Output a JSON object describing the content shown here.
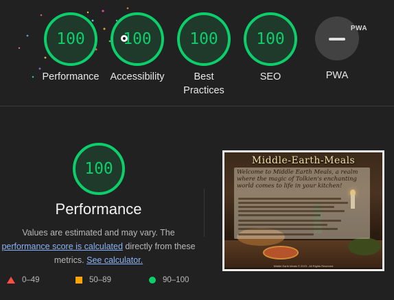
{
  "categories": [
    {
      "name": "performance",
      "score": "100",
      "label": "Performance"
    },
    {
      "name": "accessibility",
      "score": "100",
      "label": "Accessibility"
    },
    {
      "name": "best-practices",
      "score": "100",
      "label": "Best Practices"
    },
    {
      "name": "seo",
      "score": "100",
      "label": "SEO"
    }
  ],
  "pwa": {
    "badge_text": "PWA",
    "label": "PWA"
  },
  "performance_section": {
    "score": "100",
    "title": "Performance",
    "desc_prefix": "Values are estimated and may vary. The ",
    "score_link": "performance score is calculated",
    "desc_middle": " directly from these metrics. ",
    "calculator_link": "See calculator."
  },
  "thumbnail": {
    "site_title": "Middle-Earth-Meals",
    "intro": "Welcome to Middle Earth Meals, a realm where the magic of Tolkien's enchanting world comes to life in your kitchen!",
    "footer": "Middle Earth Meals © 2023 - All Rights Reserved"
  },
  "legend": [
    {
      "shape": "triangle",
      "color": "#ff4e42",
      "range": "0–49"
    },
    {
      "shape": "square",
      "color": "#ffa400",
      "range": "50–89"
    },
    {
      "shape": "circle",
      "color": "#0cce6b",
      "range": "90–100"
    }
  ],
  "colors": {
    "pass": "#0cce6b",
    "background": "#212121",
    "link": "#8ab4f8"
  }
}
